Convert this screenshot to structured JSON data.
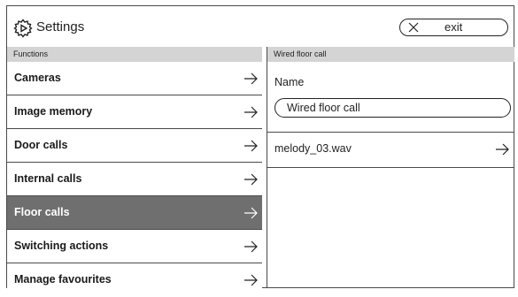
{
  "header": {
    "title": "Settings",
    "exit_label": "exit"
  },
  "functions": {
    "heading": "Functions",
    "items": [
      {
        "label": "Cameras",
        "active": false
      },
      {
        "label": "Image memory",
        "active": false
      },
      {
        "label": "Door calls",
        "active": false
      },
      {
        "label": "Internal calls",
        "active": false
      },
      {
        "label": "Floor calls",
        "active": true
      },
      {
        "label": "Switching actions",
        "active": false
      },
      {
        "label": "Manage favourites",
        "active": false
      }
    ]
  },
  "detail": {
    "heading": "Wired floor call",
    "name_label": "Name",
    "name_value": "Wired floor call",
    "melody": "melody_03.wav"
  },
  "colors": {
    "active_item_bg": "#6f6f6f",
    "section_head_bg": "#d4d4d4"
  }
}
